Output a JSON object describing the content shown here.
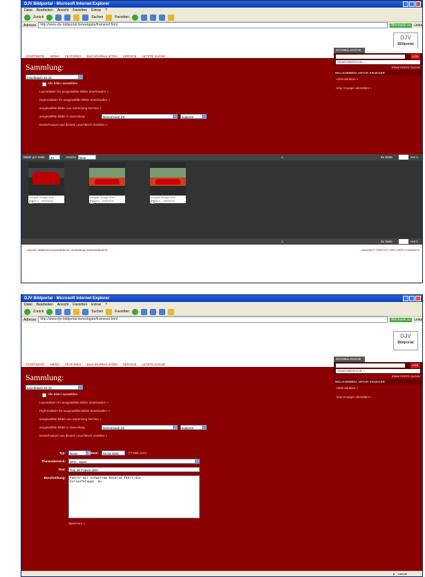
{
  "windows": [
    {
      "title": "DJV Bildportal - Microsoft Internet Explorer",
      "menu": [
        "Datei",
        "Bearbeiten",
        "Ansicht",
        "Favoriten",
        "Extras",
        "?"
      ],
      "toolbar": {
        "back": "Zurück",
        "search": "Suchen",
        "favorites": "Favoriten"
      },
      "address_label": "Adresse",
      "address": "http://www.djv-bildportal.de/webgate/frameset.html",
      "go": "Wechseln zu",
      "links": "Links"
    },
    {
      "title": "DJV Bildportal - Microsoft Internet Explorer",
      "menu": [
        "Datei",
        "Bearbeiten",
        "Ansicht",
        "Favoriten",
        "Extras",
        "?"
      ],
      "toolbar": {
        "back": "Zurück",
        "search": "Suchen",
        "favorites": "Favoriten"
      },
      "address_label": "Adresse",
      "address": "http://www.djv-bildportal.de/webgate/frameset.html",
      "go": "Wechseln zu",
      "links": "Links"
    }
  ],
  "logo": {
    "text": "DJV",
    "sub": "Bildportal"
  },
  "nav": [
    "STARTSEITE",
    "NEWS",
    "FEATURES",
    "BILDJOURNALISTEN",
    "SERVICE",
    "LETZTE SUCHE"
  ],
  "page": {
    "heading": "Sammlung:",
    "leuchttisch": "Leuchttisch 20 (3)",
    "select_all": "Alle Bilder auswählen",
    "actions": [
      "Layoutdaten für ausgewählte Bilder downloaden »",
      "Highresdaten für ausgewählte Bilder downloaden »",
      "ausgewählte Bilder aus Sammlung löschen »"
    ],
    "move_label": "ausgewählte Bilder in Sammlung",
    "move_target": "Demo(Gast) (0)",
    "move_mode": "kopieren",
    "create_news": "News/Feature aus diesem Leuchttisch erstellen »"
  },
  "sidebar": {
    "tab": "SCHNELLSUCHE",
    "search_button": "LOS",
    "themen": "THEMENBEREICHE »",
    "extended": "ERWEITERTE SUCHE",
    "welcome": "WILLKOMMEN, ARTUR KRUEGER",
    "admin": "Administration »",
    "logout": "Artur Krueger abmelden »"
  },
  "gallery": {
    "per_page_label": "Bilder pro Seite",
    "per_page": "40",
    "view_label": "Ansicht",
    "view": "klein",
    "page_num": "1",
    "goto_label": "Zu Seite",
    "of": "von 1",
    "items": [
      {
        "caption": "Fotograf: Krueger Artur",
        "id": "Bild-n. : 000000012"
      },
      {
        "caption": "Fotograf: Krueger Artur",
        "id": "Bild-n. : 000000011"
      },
      {
        "caption": "Fotograf: Krueger Artur",
        "id": "Bild-n. : 000000010"
      }
    ]
  },
  "footer": {
    "left": "support: bildportal-support@djv.de  |  anmeldung: bildportal@djv.de",
    "right": "copyright © 2005 DJV VWG  |  AGB  |  Impressum"
  },
  "form": {
    "typ_label": "Typ:",
    "typ": "News",
    "datum_label": "Datum:",
    "datum": "15.03.2006",
    "datum_hint": "(TT.MM.JJJJ)",
    "themen_label": "Themenbereich:",
    "themen": "SPO - Sport",
    "titel_label": "Titel:",
    "titel": "Tour de France 2007",
    "beschreibung_label": "Beschreibung:",
    "beschreibung": "Fahrer mit schwarzem Renarad fährt die\nVorlaufetappe  an.",
    "save": "Speichern »"
  },
  "statusbar": {
    "zone": "Internet"
  }
}
